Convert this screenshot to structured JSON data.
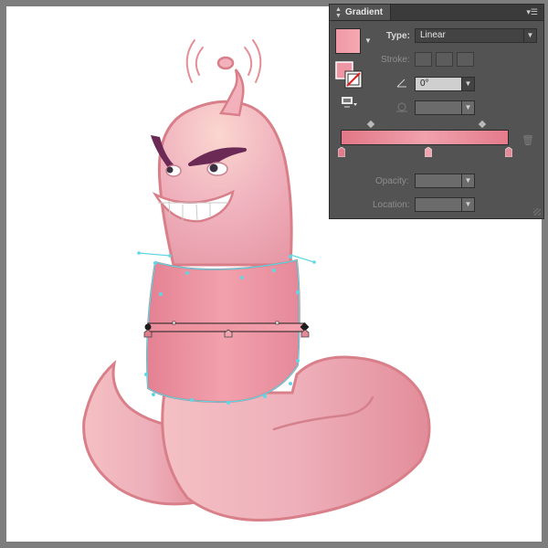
{
  "panel": {
    "title": "Gradient",
    "menu_icon": "panel-menu-icon",
    "type_label": "Type:",
    "type_value": "Linear",
    "stroke_label": "Stroke:",
    "angle_value": "0°",
    "opacity_label": "Opacity:",
    "location_label": "Location:"
  },
  "colors": {
    "panel_bg": "#535353",
    "worm_pink": "#f0a6b4",
    "outline": "#d87f8a",
    "selection": "#5fd9e6"
  }
}
